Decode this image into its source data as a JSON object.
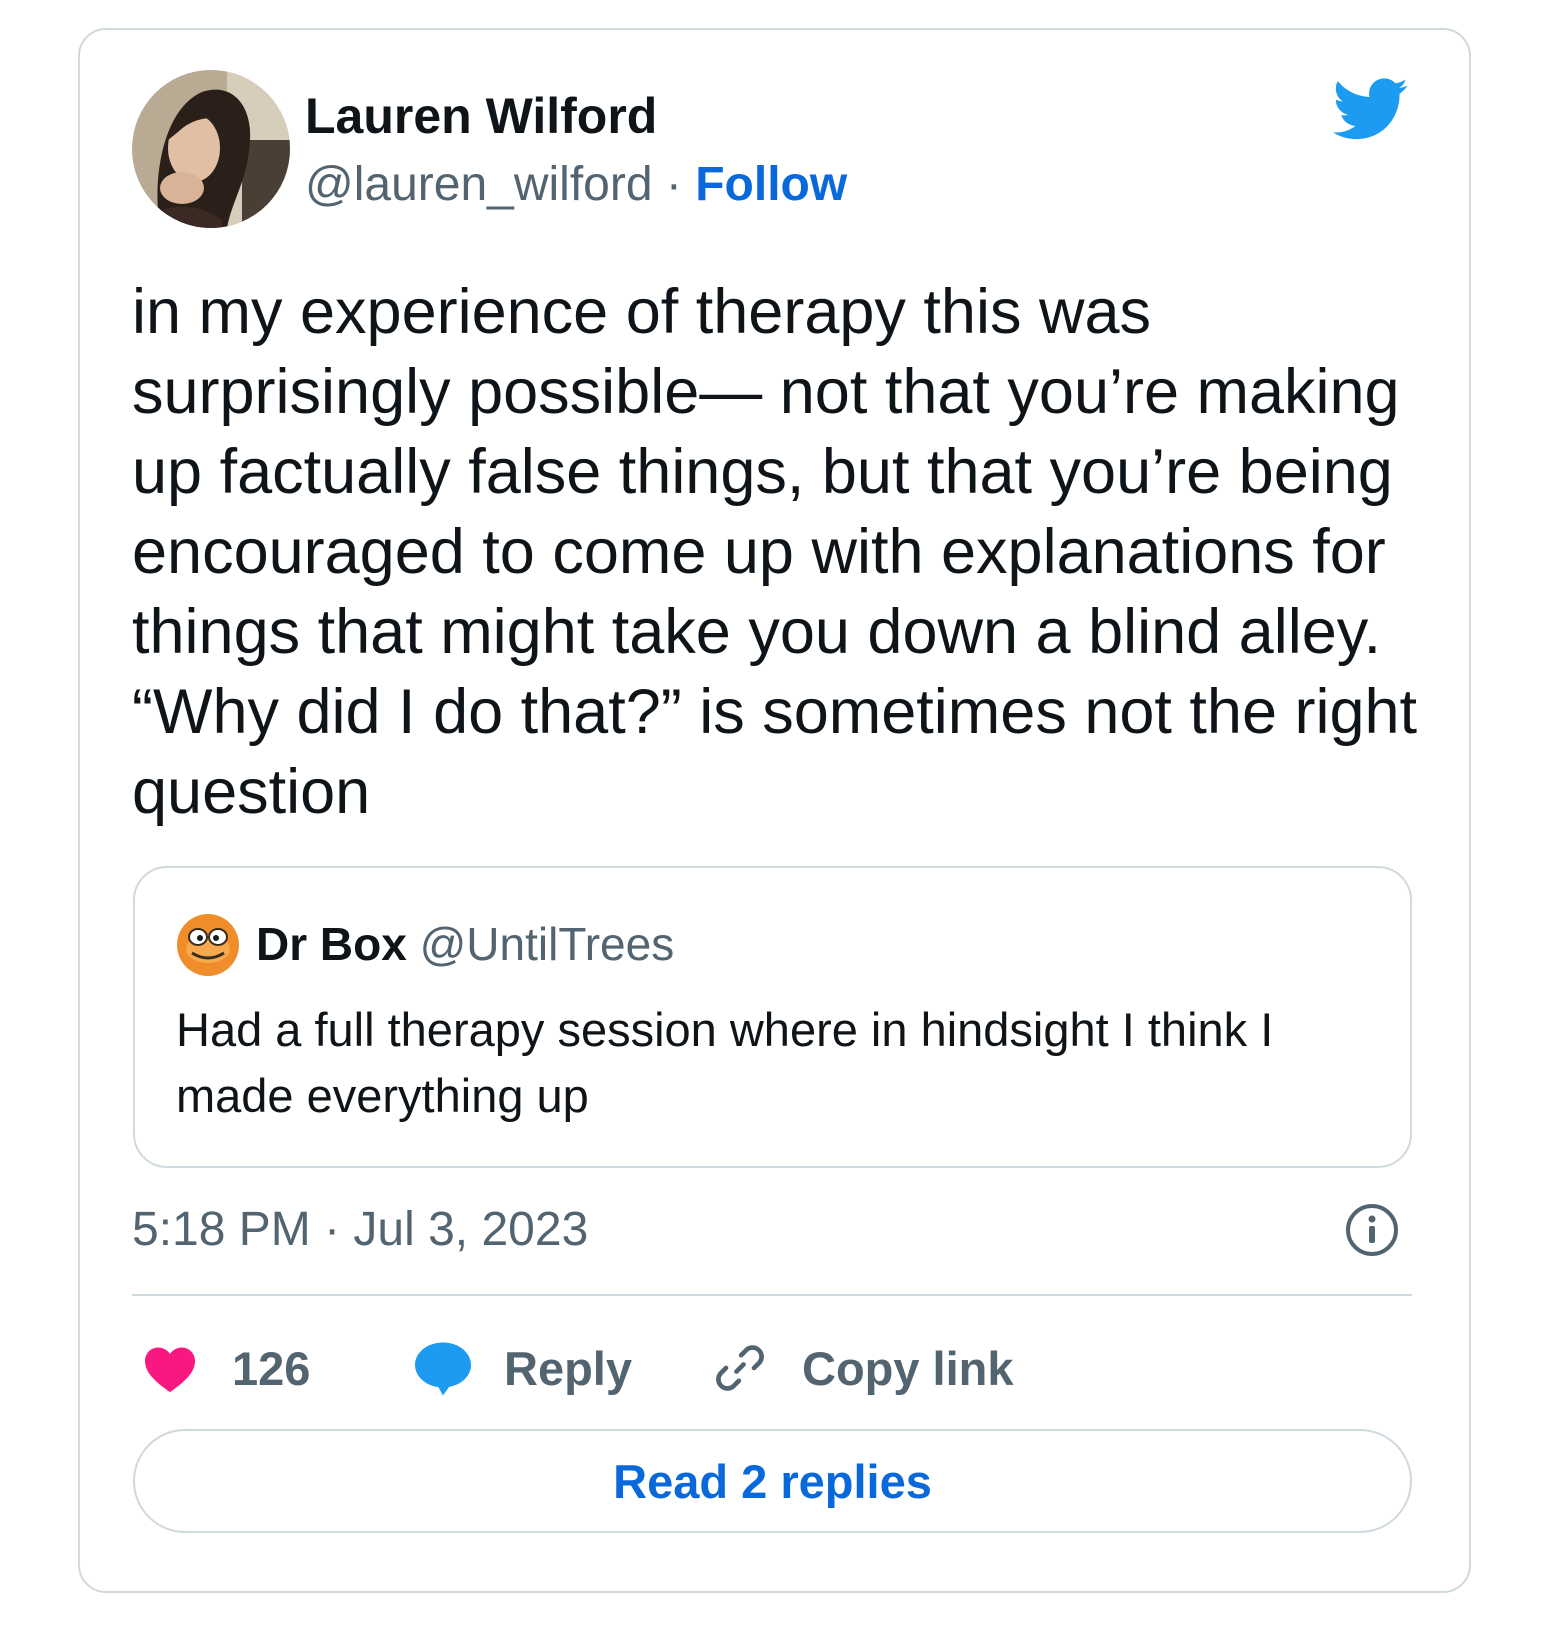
{
  "author": {
    "name": "Lauren Wilford",
    "handle": "@lauren_wilford",
    "separator": " · ",
    "follow_label": "Follow"
  },
  "tweet": {
    "text": "in my experience of therapy this was surprisingly possible— not that you’re making up factually false things, but that you’re being encouraged to come up with explanations for things that might take you down a blind alley. “Why did I do that?” is sometimes not the right question"
  },
  "quoted_tweet": {
    "name": "Dr Box",
    "handle": "@UntilTrees",
    "text": "Had a full therapy session where in hindsight I think I made everything up"
  },
  "timestamp": "5:18 PM · Jul 3, 2023",
  "actions": {
    "like_count": "126",
    "reply_label": "Reply",
    "copy_link_label": "Copy link"
  },
  "read_replies_label": "Read 2 replies",
  "colors": {
    "link_blue": "#0969da",
    "twitter_blue": "#1d9bf0",
    "heart_pink": "#f91880",
    "muted_text": "#536471",
    "border": "#cfd9de"
  },
  "icons": [
    "twitter-bird-icon",
    "info-icon",
    "heart-icon",
    "reply-bubble-icon",
    "link-icon"
  ]
}
